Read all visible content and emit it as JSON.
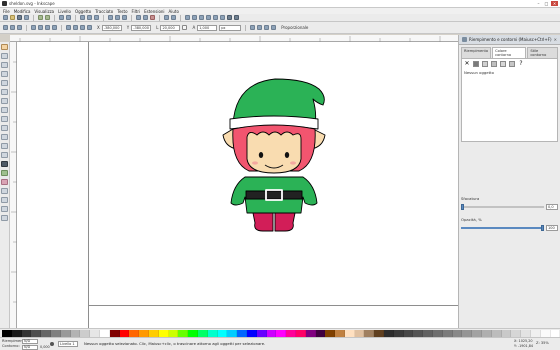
{
  "window": {
    "title": "sheldon.svg - Inkscape"
  },
  "menubar": {
    "items": [
      "File",
      "Modifica",
      "Visualizza",
      "Livello",
      "Oggetto",
      "Tracciato",
      "Testo",
      "Filtri",
      "Estensioni",
      "Aiuto"
    ]
  },
  "controls": {
    "x_label": "X",
    "x_value": "-380,000",
    "y_label": "Y",
    "y_value": "-380,000",
    "w_label": "L",
    "w_value": "20,000",
    "h_label": "A",
    "h_value": "1,000",
    "unit": "px",
    "toggle_label": "Proporzionale"
  },
  "panel": {
    "title": "Riempimento e contorni (Maiusc+Ctrl+F)",
    "tabs": [
      "Riempimento",
      "Colore contorno",
      "Stile contorno"
    ],
    "active_tab_index": 1,
    "no_selection": "Nessun oggetto",
    "blur_label": "Sfocatura",
    "blur_value": "0,0",
    "opacity_label": "Opacità, %",
    "opacity_value": "100",
    "opacity_fraction": 1.0
  },
  "status": {
    "fill_label": "Riempimento:",
    "stroke_label": "Contorno:",
    "fill_value": "N/D",
    "stroke_value": "N/D",
    "stroke_width": "0,000",
    "layer": "Livello 1",
    "message": "Nessun oggetto selezionato. Clic, Maiusc+clic, o trascinare attorno agli oggetti per selezionare.",
    "coord_x": "X: 1025,20",
    "coord_y": "Y: -1901,84",
    "zoom": "Z: 35%"
  },
  "palette": {
    "colors": [
      "#000000",
      "#1a1a1a",
      "#333333",
      "#4d4d4d",
      "#666666",
      "#808080",
      "#999999",
      "#b3b3b3",
      "#cccccc",
      "#e6e6e6",
      "#ffffff",
      "#800000",
      "#ff0000",
      "#ff6600",
      "#ff9900",
      "#ffcc00",
      "#ffff00",
      "#ccff00",
      "#66ff00",
      "#00ff00",
      "#00ff66",
      "#00ffcc",
      "#00ffff",
      "#00ccff",
      "#0066ff",
      "#0000ff",
      "#6600ff",
      "#cc00ff",
      "#ff00ff",
      "#ff0099",
      "#ff0066",
      "#800080",
      "#400040",
      "#804000",
      "#c08040",
      "#ffe0c0",
      "#e0c0a0",
      "#a08060",
      "#604020",
      "#2d2d2d",
      "#3a3a3a",
      "#474747",
      "#545454",
      "#616161",
      "#6e6e6e",
      "#7b7b7b",
      "#888888",
      "#959595",
      "#a2a2a2",
      "#afafaf",
      "#bcbcbc",
      "#c9c9c9",
      "#d6d6d6",
      "#e3e3e3",
      "#f0f0f0",
      "#fafafa",
      "#ffffff"
    ]
  },
  "artwork": {
    "colors": {
      "hat": "#2bb256",
      "hat_trim": "#ffffff",
      "hair": "#f2556f",
      "skin": "#f9dcb0",
      "body": "#2bb256",
      "belt": "#222222",
      "buckle": "#ffffff",
      "boots": "#d21e58",
      "outline": "#000000"
    }
  }
}
